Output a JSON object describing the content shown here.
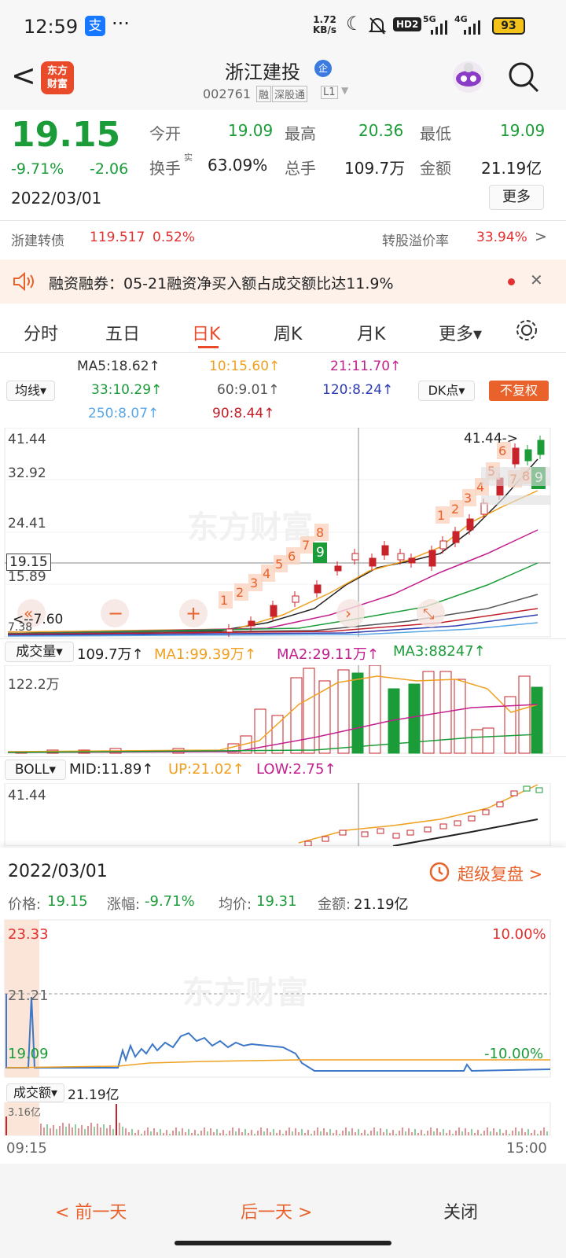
{
  "status": {
    "time": "12:59",
    "alipay": "支",
    "dots": "···",
    "speed_top": "1.72",
    "speed_bot": "KB/s",
    "hd": "HD2",
    "sig5g": "5G",
    "sig4g": "4G",
    "battery": "93"
  },
  "header": {
    "back": "<",
    "logo_top": "东方",
    "logo_bot": "财富",
    "title": "浙江建投",
    "badge": "企",
    "code": "002761",
    "tag1": "融",
    "tag2": "深股通",
    "tag3": "L1"
  },
  "quote": {
    "price": "19.15",
    "pct": "-9.71%",
    "chg": "-2.06",
    "date": "2022/03/01",
    "open_label": "今开",
    "open": "19.09",
    "high_label": "最高",
    "high": "20.36",
    "low_label": "最低",
    "low": "19.09",
    "turn_label": "换手",
    "turn_sup": "实",
    "turn": "63.09%",
    "vol_label": "总手",
    "vol": "109.7万",
    "amt_label": "金额",
    "amt": "21.19亿",
    "more": "更多"
  },
  "bond": {
    "name": "浙建转债",
    "price": "119.517",
    "pct": "0.52%",
    "prem_label": "转股溢价率",
    "prem": "33.94%",
    "arrow": ">"
  },
  "notice": {
    "text": "融资融券：05-21融资净买入额占成交额比达11.9%",
    "close": "✕"
  },
  "tabs": [
    "分时",
    "五日",
    "日K",
    "周K",
    "月K",
    "更多▾"
  ],
  "ma": {
    "ma5": "MA5:18.62↑",
    "ma10": "10:15.60↑",
    "ma21": "21:11.70↑",
    "ma33": "33:10.29↑",
    "ma60": "60:9.01↑",
    "ma120": "120:8.24↑",
    "ma250": "250:8.07↑",
    "ma90": "90:8.44↑",
    "junxian": "均线▾",
    "dk": "DK点▾",
    "fq": "不复权"
  },
  "kchart": {
    "y1": "41.44",
    "y2": "32.92",
    "y3": "24.41",
    "y4": "15.89",
    "y5": "7.38",
    "cross": "19.15",
    "max_label": "41.44->",
    "min_label": "<--7.60",
    "watermark": "东方财富",
    "buy_seq": [
      "1",
      "2",
      "3",
      "4",
      "5",
      "6",
      "7",
      "8",
      "9"
    ],
    "up_seq": [
      "1",
      "2",
      "3",
      "4",
      "5",
      "6",
      "7",
      "8",
      "9"
    ]
  },
  "volbar": {
    "sel": "成交量▾",
    "v": "109.7万↑",
    "ma1": "MA1:99.39万↑",
    "ma2": "MA2:29.11万↑",
    "ma3": "MA3:88247↑",
    "top": "122.2万"
  },
  "boll": {
    "sel": "BOLL▾",
    "mid": "MID:11.89↑",
    "up": "UP:21.02↑",
    "low": "LOW:2.75↑",
    "top": "41.44"
  },
  "detail": {
    "date": "2022/03/01",
    "replay": "超级复盘 >",
    "price": "价格:",
    "price_v": "19.15",
    "rise": "涨幅:",
    "rise_v": "-9.71%",
    "avg": "均价:",
    "avg_v": "19.31",
    "amt": "金额:",
    "amt_v": "21.19亿"
  },
  "intraday": {
    "y_top": "23.33",
    "y_mid": "21.21",
    "y_bot": "19.09",
    "p_top": "10.00%",
    "p_bot": "-10.00%",
    "amt_sel": "成交额▾",
    "amt": "21.19亿",
    "amt_top": "3.16亿",
    "t0": "09:15",
    "t1": "15:00"
  },
  "bottom": {
    "prev": "< 前一天",
    "next": "后一天 >",
    "close": "关闭"
  }
}
